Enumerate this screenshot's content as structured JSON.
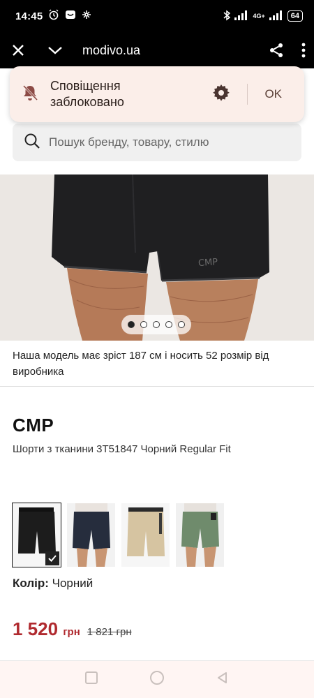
{
  "status_bar": {
    "time": "14:45",
    "network": "4G+",
    "battery": "64",
    "icons": [
      "alarm-icon",
      "message-icon",
      "pinwheel-icon",
      "bluetooth-icon",
      "signal-icon",
      "battery-icon"
    ]
  },
  "browser": {
    "url": "modivo.ua",
    "icons": [
      "close-icon",
      "chevron-down-icon",
      "share-icon",
      "more-vert-icon"
    ]
  },
  "notification": {
    "text_line1": "Сповіщення",
    "text_line2": "заблоковано",
    "ok_label": "OK",
    "icons": [
      "bell-off-icon",
      "gear-icon"
    ]
  },
  "search": {
    "placeholder": "Пошук бренду, товару, стилю",
    "icon": "search-icon"
  },
  "gallery": {
    "logo_text": "CMP",
    "slides": 5,
    "active_slide": 1
  },
  "product": {
    "model_note": "Наша модель має зріст 187 см і носить 52 розмір від виробника",
    "brand": "CMP",
    "name": "Шорти з тканини 3T51847 Чорний Regular Fit",
    "color_label": "Колір:",
    "color_value": "Чорний",
    "price": "1 520",
    "currency": "грн",
    "old_price": "1 821 грн",
    "accent_color": "#b02a2f",
    "variants": [
      {
        "name": "Чорний",
        "color": "#1c1c1c",
        "selected": true
      },
      {
        "name": "navy",
        "color": "#262d3d",
        "selected": false
      },
      {
        "name": "beige",
        "color": "#d6c4a1",
        "selected": false
      },
      {
        "name": "green",
        "color": "#6f8b6c",
        "selected": false
      }
    ]
  },
  "nav_bar": {
    "icons": [
      "recents-icon",
      "home-icon",
      "back-icon"
    ]
  }
}
